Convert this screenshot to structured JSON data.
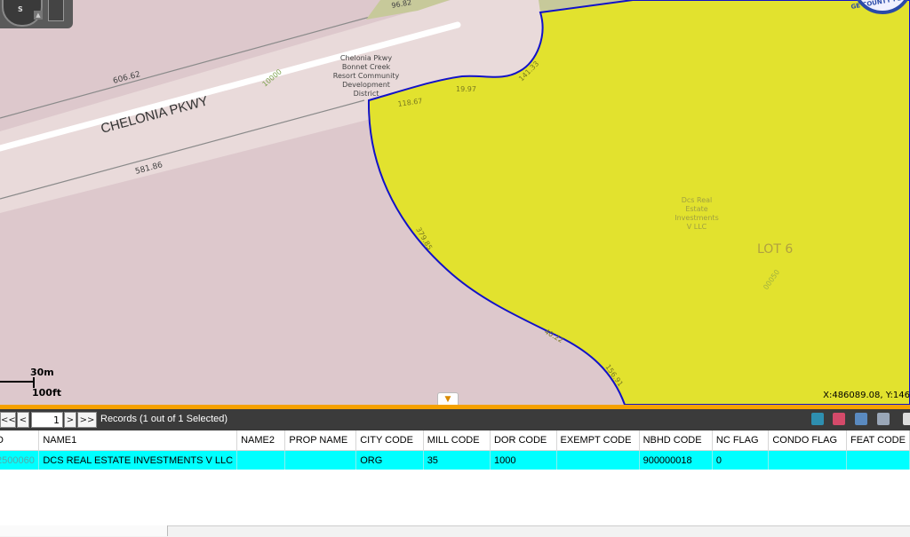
{
  "map": {
    "road_name": "CHELONIA PKWY",
    "dim_606": "606.62",
    "dim_581": "581.86",
    "dim_96": "96.82",
    "dim_118": "118.67",
    "dim_19": "19.97",
    "dim_141": "141.33",
    "dim_379": "379.85",
    "dim_40": "40.22",
    "dim_156": "156.91",
    "code_10000": "10000",
    "code_00050": "00050",
    "district_label": [
      "Chelonia Pkwy",
      "Bonnet Creek",
      "Resort Community",
      "Development",
      "District"
    ],
    "owner_label": [
      "Dcs Real",
      "Estate",
      "Investments",
      "V LLC"
    ],
    "lot_label": "LOT 6",
    "seal_text": "GE COUNTY FLO",
    "scale_metric": "30m",
    "scale_imperial": "100ft",
    "coordinates": "X:486089.08, Y:146",
    "compass_s": "S",
    "colors": {
      "parcel_fill": "#e2e22e",
      "parcel_border": "#1212c8",
      "map_bg": "#ddc8cc",
      "accent": "#f5a100"
    }
  },
  "toolbar": {
    "first": "<<",
    "prev": "<",
    "page_value": "1",
    "next": ">",
    "last": ">>",
    "records_text": "Records (1 out of 1 Selected)",
    "icons": [
      "zoom-to-icon",
      "flash-icon",
      "map-select-icon",
      "options-icon"
    ]
  },
  "table": {
    "columns": [
      "D",
      "NAME1",
      "NAME2",
      "PROP NAME",
      "CITY CODE",
      "MILL CODE",
      "DOR CODE",
      "EXEMPT CODE",
      "NBHD CODE",
      "NC FLAG",
      "CONDO FLAG",
      "FEAT CODE"
    ],
    "rows": [
      [
        "2500060",
        "DCS REAL ESTATE INVESTMENTS V LLC",
        "",
        "",
        "ORG",
        "35",
        "1000",
        "",
        "900000018",
        "0",
        "",
        ""
      ]
    ]
  }
}
